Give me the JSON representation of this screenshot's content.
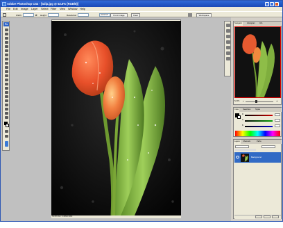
{
  "title": "Adobe Photoshop CS2 - [tulip.jpg @ 52.6% (RGB/8)]",
  "menu": [
    "File",
    "Edit",
    "Image",
    "Layer",
    "Select",
    "Filter",
    "View",
    "Window",
    "Help"
  ],
  "options": {
    "width_label": "Width:",
    "height_label": "Height:",
    "resolution_label": "Resolution:",
    "resolution_unit": "pixels/inch",
    "front_image": "Front Image",
    "clear": "Clear",
    "workspace": "Workspace"
  },
  "toolbox": {
    "logo": "Ps"
  },
  "status": {
    "text": "52.6%   Doc: 3.46M/3.46M"
  },
  "navigator": {
    "tabs": [
      "Navigator",
      "Histogram",
      "Info"
    ],
    "zoom": "52.6%"
  },
  "color": {
    "tabs": [
      "Color",
      "Swatches",
      "Styles"
    ],
    "channels": [
      "R",
      "G",
      "B"
    ],
    "colors": {
      "red": "#d00000",
      "green": "#00a000",
      "blue": "#0000d0"
    }
  },
  "layers": {
    "tabs": [
      "Layers",
      "Channels",
      "Paths"
    ],
    "layer_name": "Background"
  },
  "colors": {
    "title_bar": "#1a49b7",
    "work_area": "#c0c0c0",
    "selection": "#316ac5"
  }
}
